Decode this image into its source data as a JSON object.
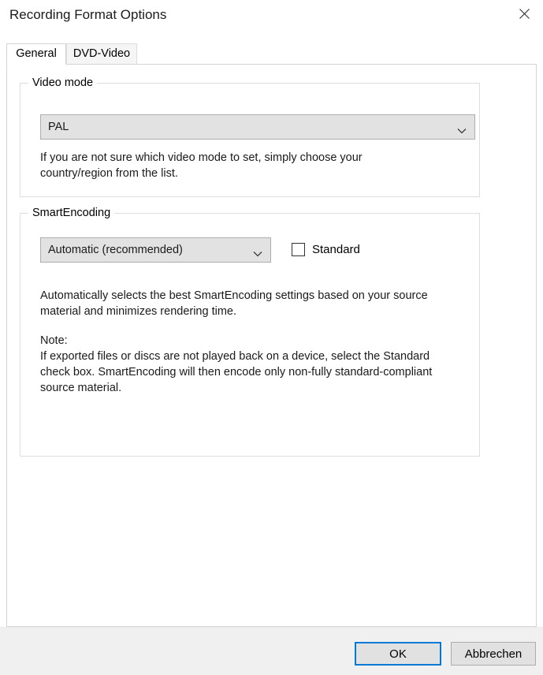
{
  "window": {
    "title": "Recording Format Options",
    "close_icon": "close-icon"
  },
  "tabs": [
    {
      "label": "General",
      "selected": true
    },
    {
      "label": "DVD-Video",
      "selected": false
    }
  ],
  "groups": {
    "video_mode": {
      "legend": "Video mode",
      "combo": {
        "value": "PAL",
        "arrow_icon": "chevron-down-icon"
      },
      "help_text": "If you are not sure which video mode to set, simply choose your\ncountry/region from the list."
    },
    "smart_encoding": {
      "legend": "SmartEncoding",
      "combo": {
        "value": "Automatic (recommended)",
        "arrow_icon": "chevron-down-icon"
      },
      "checkbox": {
        "label": "Standard",
        "checked": false
      },
      "description": "Automatically selects the best SmartEncoding settings based on your source\nmaterial and minimizes rendering time.",
      "note_heading": "Note:",
      "note_body": "If exported files or discs are not played back on a device, select the Standard\ncheck box. SmartEncoding will then encode only non-fully standard-compliant\nsource material."
    }
  },
  "footer": {
    "ok_label": "OK",
    "cancel_label": "Abbrechen"
  },
  "colors": {
    "focus_accent": "#0078d7",
    "button_face": "#e1e1e1",
    "footer_bg": "#f0f0f0",
    "combo_bg": "#e2e2e2"
  }
}
